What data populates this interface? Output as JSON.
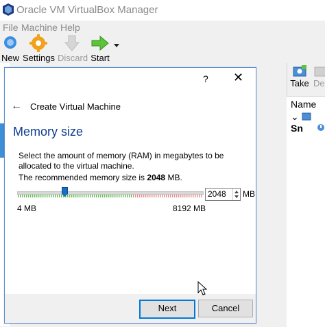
{
  "window": {
    "title": "Oracle VM VirtualBox Manager",
    "menu": [
      "File",
      "Machine",
      "Help"
    ]
  },
  "toolbar": {
    "new_label": "New",
    "settings_label": "Settings",
    "discard_label": "Discard",
    "start_label": "Start"
  },
  "right_panel": {
    "take_label": "Take",
    "delete_label": "Del",
    "column_header": "Name",
    "group_label": "Sn"
  },
  "dialog": {
    "help_glyph": "?",
    "close_glyph": "✕",
    "back_glyph": "←",
    "wizard_title": "Create Virtual Machine",
    "page_title": "Memory size",
    "description": "Select the amount of memory (RAM) in megabytes to be allocated to the virtual machine.",
    "recommend_prefix": "The recommended memory size is ",
    "recommend_value": "2048",
    "recommend_suffix": " MB.",
    "memory_value": "2048",
    "memory_fraction": 0.25,
    "unit": "MB",
    "min_label": "4 MB",
    "max_label": "8192 MB",
    "next_label": "Next",
    "cancel_label": "Cancel"
  },
  "colors": {
    "accent": "#0078d7",
    "page_title": "#0f3d91",
    "slider_thumb": "#1770c6",
    "tick_green": "#5fbf4d",
    "tick_red": "#e88a8a"
  }
}
